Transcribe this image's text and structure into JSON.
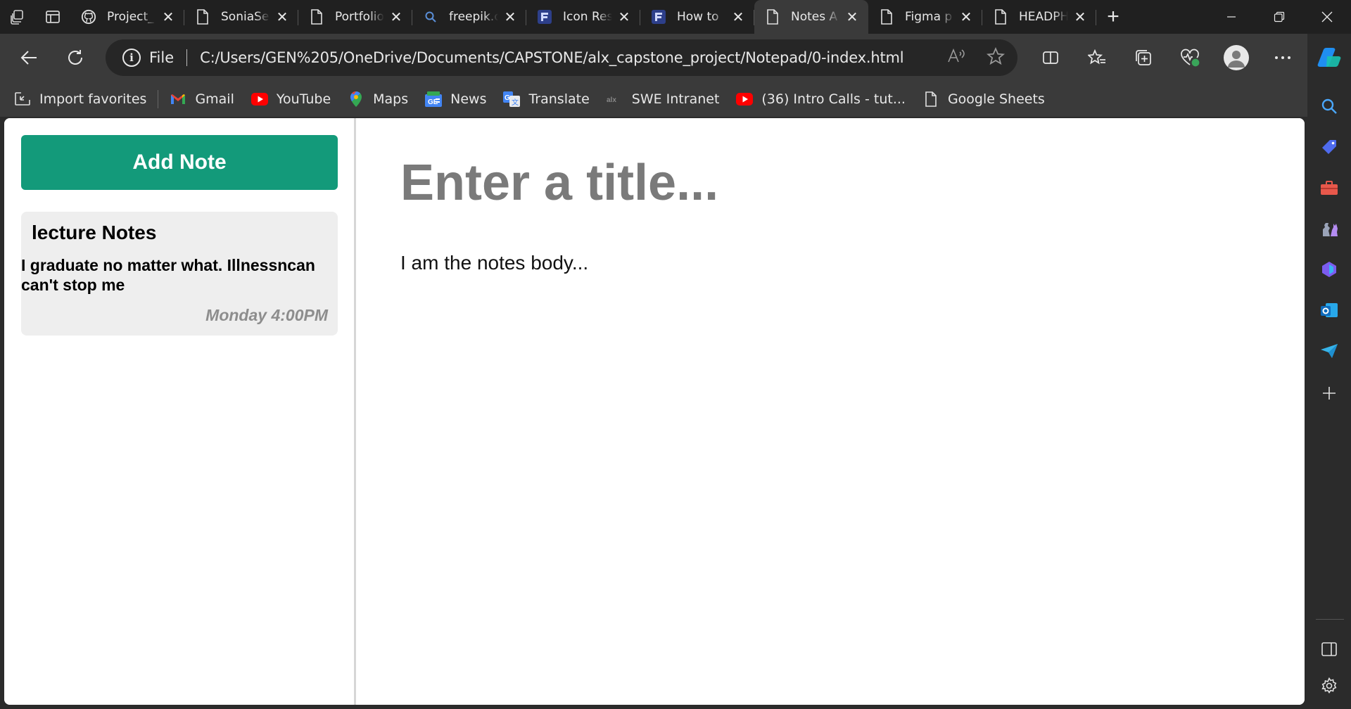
{
  "browser": {
    "tabs": [
      {
        "label": "Project_",
        "icon": "github-icon",
        "active": false
      },
      {
        "label": "SoniaSel",
        "icon": "page-icon",
        "active": false
      },
      {
        "label": "Portfolio",
        "icon": "page-icon",
        "active": false
      },
      {
        "label": "freepik.c",
        "icon": "search-icon",
        "active": false
      },
      {
        "label": "Icon Res",
        "icon": "figma-f-icon",
        "active": false
      },
      {
        "label": "How to",
        "icon": "figma-f-icon",
        "active": false
      },
      {
        "label": "Notes A",
        "icon": "page-icon",
        "active": true
      },
      {
        "label": "Figma p",
        "icon": "page-icon",
        "active": false
      },
      {
        "label": "HEADPH",
        "icon": "page-icon",
        "active": false
      }
    ],
    "address": {
      "scheme": "File",
      "url": "C:/Users/GEN%205/OneDrive/Documents/CAPSTONE/alx_capstone_project/Notepad/0-index.html"
    },
    "favorites": [
      {
        "label": "Import favorites",
        "icon": "import-icon"
      },
      {
        "label": "Gmail",
        "icon": "gmail-icon"
      },
      {
        "label": "YouTube",
        "icon": "youtube-icon"
      },
      {
        "label": "Maps",
        "icon": "maps-icon"
      },
      {
        "label": "News",
        "icon": "news-icon"
      },
      {
        "label": "Translate",
        "icon": "translate-icon"
      },
      {
        "label": "SWE Intranet",
        "icon": "alx-icon"
      },
      {
        "label": "(36) Intro Calls - tut...",
        "icon": "youtube-icon"
      },
      {
        "label": "Google Sheets",
        "icon": "page-icon"
      }
    ],
    "colors": {
      "accent": "#139a7a",
      "tab_bg": "#202020",
      "toolbar_bg": "#3a3a3a"
    }
  },
  "app": {
    "add_note_label": "Add Note",
    "notes": [
      {
        "title": "lecture Notes",
        "body": "I graduate no matter what. Illnessncan can't stop me",
        "date": "Monday 4:00PM"
      }
    ],
    "editor": {
      "title_placeholder": "Enter a title...",
      "body_placeholder": "I am the notes body..."
    }
  }
}
